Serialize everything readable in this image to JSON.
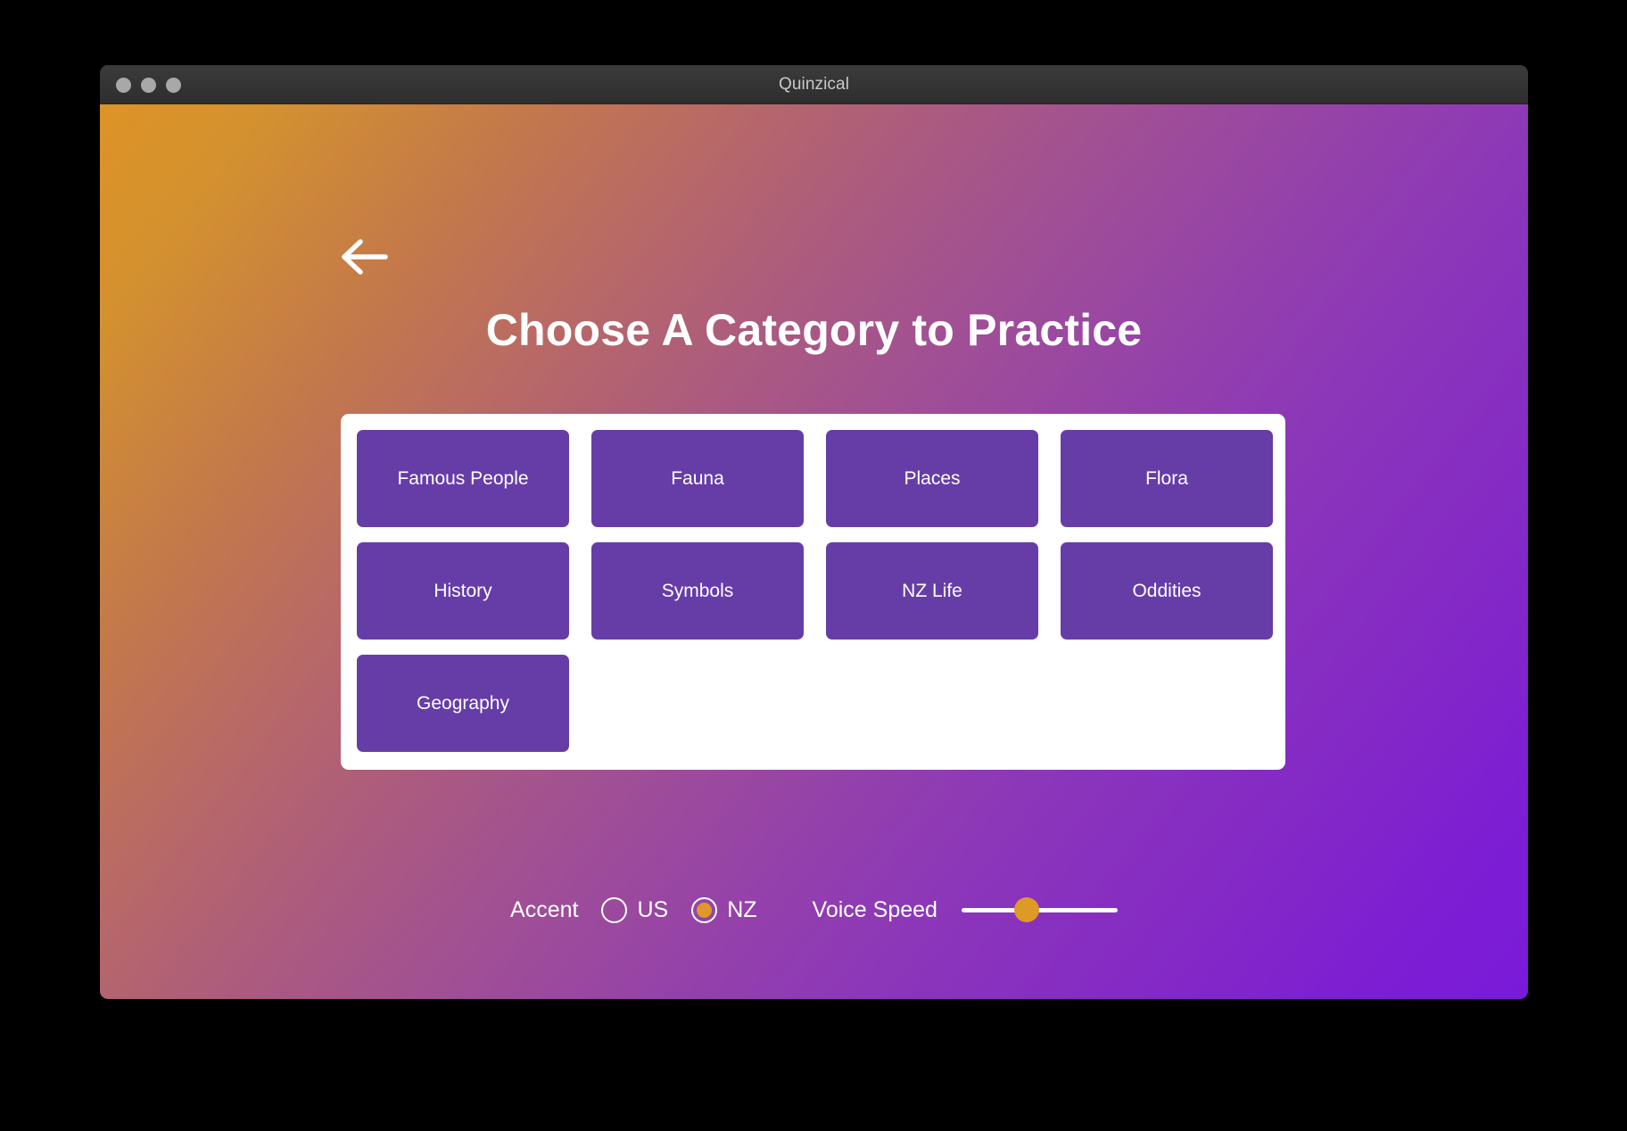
{
  "window": {
    "title": "Quinzical",
    "traffic_lights": [
      "close-button",
      "minimize-button",
      "maximize-button"
    ]
  },
  "nav": {
    "back_icon": "arrow-left-icon"
  },
  "main": {
    "heading": "Choose A Category to Practice",
    "categories": [
      "Famous People",
      "Fauna",
      "Places",
      "Flora",
      "History",
      "Symbols",
      "NZ Life",
      "Oddities",
      "Geography"
    ]
  },
  "controls": {
    "accent_label": "Accent",
    "accent_options": [
      {
        "label": "US",
        "selected": false
      },
      {
        "label": "NZ",
        "selected": true
      }
    ],
    "voice_speed_label": "Voice Speed",
    "voice_speed_percent": 42
  },
  "colors": {
    "gradient_start": "#dd9326",
    "gradient_end": "#7a1ada",
    "button_purple": "#663da7",
    "accent_amber": "#dd9a27",
    "card_white": "#ffffff",
    "titlebar_gray": "#343434"
  }
}
